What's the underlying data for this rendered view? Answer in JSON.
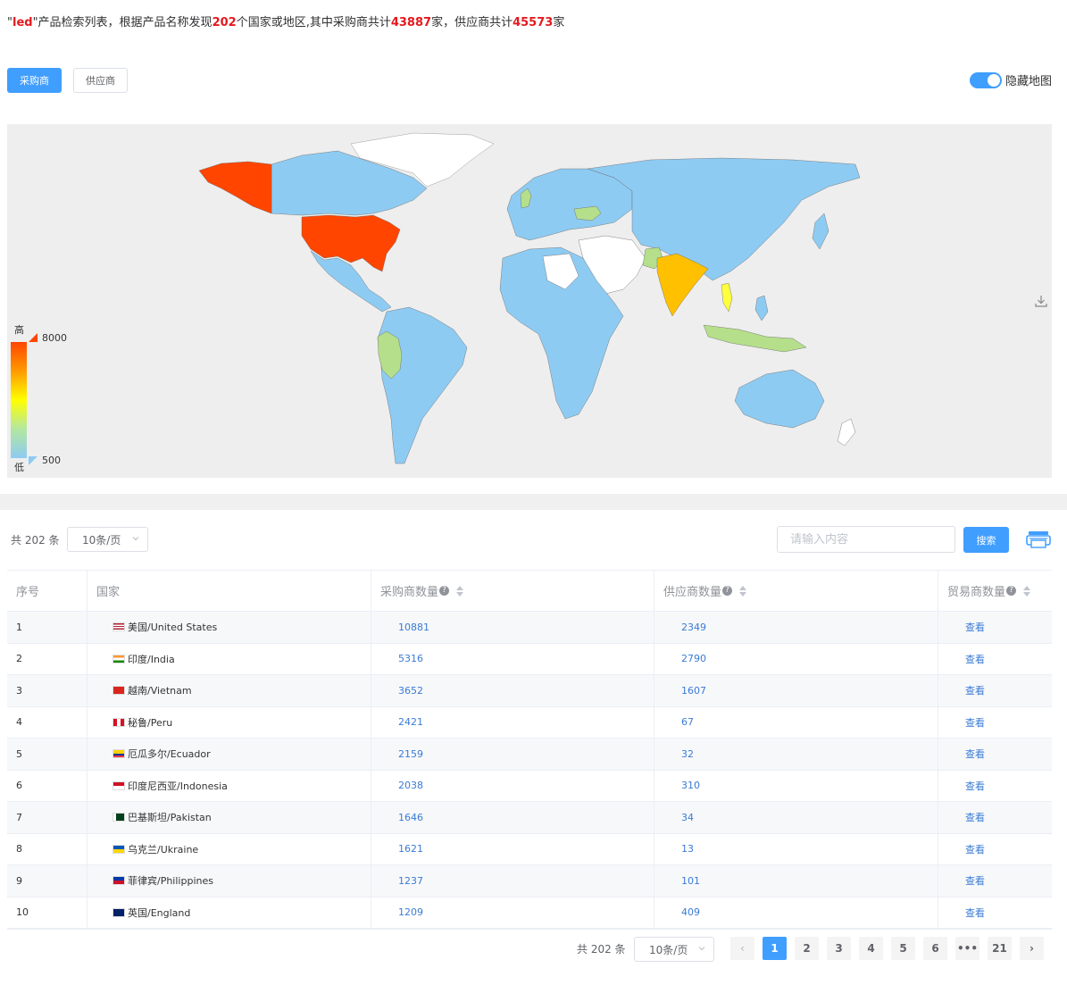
{
  "summary": {
    "q1": "\"",
    "keyword": "led",
    "q2": "\"产品检索列表，根据产品名称发现",
    "countries": "202",
    "mid": "个国家或地区,其中采购商共计",
    "buyers": "43887",
    "mid2": "家，供应商共计",
    "suppliers": "45573",
    "end": "家"
  },
  "tabs": {
    "buyers": "采购商",
    "suppliers": "供应商"
  },
  "toggle": {
    "label": "隐藏地图",
    "on": true
  },
  "legend": {
    "high": "高",
    "low": "低",
    "max": "8000",
    "min": "500"
  },
  "colors": {
    "primary": "#409eff",
    "highlight": "#e4191e",
    "top": "#ff4500",
    "mid": "#ffc000",
    "low": "#8ecbf2"
  },
  "toolbar": {
    "total": "共 202 条",
    "pagesize": "10条/页",
    "search_placeholder": "请输入内容",
    "search_button": "搜索"
  },
  "table": {
    "headers": [
      "序号",
      "国家",
      "采购商数量",
      "供应商数量",
      "贸易商数量"
    ],
    "view_label": "查看",
    "rows": [
      {
        "idx": "1",
        "country": "美国/United States",
        "buyers": "10881",
        "suppliers": "2349",
        "flag": "us"
      },
      {
        "idx": "2",
        "country": "印度/India",
        "buyers": "5316",
        "suppliers": "2790",
        "flag": "in"
      },
      {
        "idx": "3",
        "country": "越南/Vietnam",
        "buyers": "3652",
        "suppliers": "1607",
        "flag": "vn"
      },
      {
        "idx": "4",
        "country": "秘鲁/Peru",
        "buyers": "2421",
        "suppliers": "67",
        "flag": "pe"
      },
      {
        "idx": "5",
        "country": "厄瓜多尔/Ecuador",
        "buyers": "2159",
        "suppliers": "32",
        "flag": "ec"
      },
      {
        "idx": "6",
        "country": "印度尼西亚/Indonesia",
        "buyers": "2038",
        "suppliers": "310",
        "flag": "id"
      },
      {
        "idx": "7",
        "country": "巴基斯坦/Pakistan",
        "buyers": "1646",
        "suppliers": "34",
        "flag": "pk"
      },
      {
        "idx": "8",
        "country": "乌克兰/Ukraine",
        "buyers": "1621",
        "suppliers": "13",
        "flag": "ua"
      },
      {
        "idx": "9",
        "country": "菲律宾/Philippines",
        "buyers": "1237",
        "suppliers": "101",
        "flag": "ph"
      },
      {
        "idx": "10",
        "country": "英国/England",
        "buyers": "1209",
        "suppliers": "409",
        "flag": "gb"
      }
    ]
  },
  "pagination": {
    "total": "共 202 条",
    "pagesize": "10条/页",
    "pages": [
      "1",
      "2",
      "3",
      "4",
      "5",
      "6",
      "•••",
      "21"
    ],
    "current": "1"
  }
}
